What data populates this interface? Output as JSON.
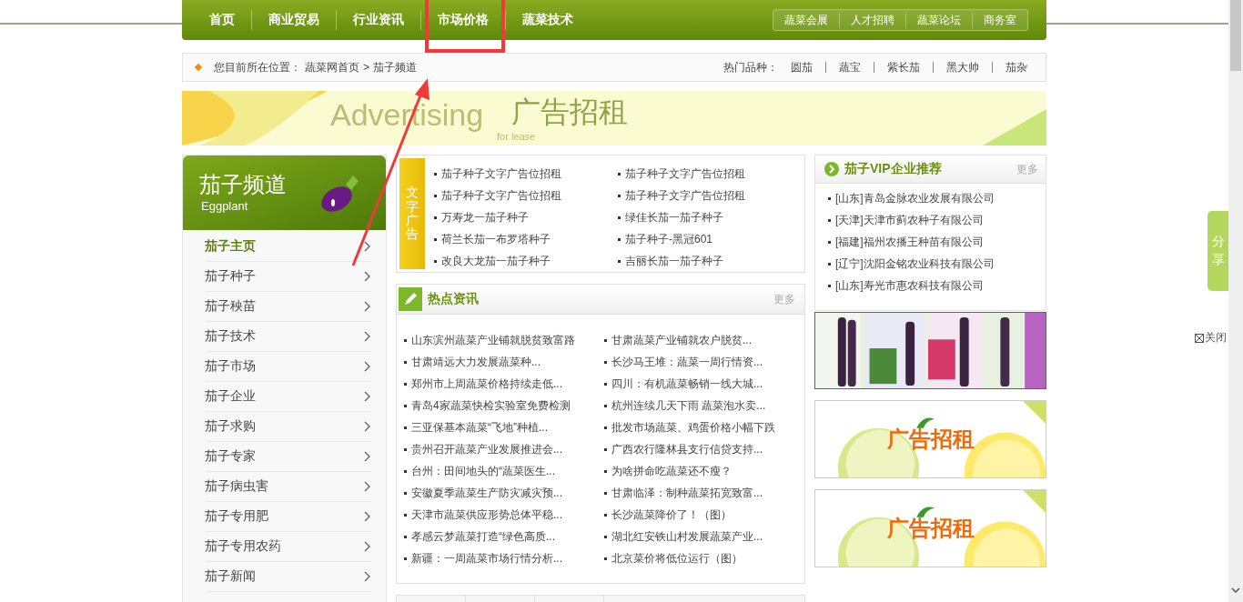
{
  "nav": {
    "items": [
      {
        "label": "首页",
        "annotated": false
      },
      {
        "label": "商业贸易",
        "annotated": false
      },
      {
        "label": "行业资讯",
        "annotated": false
      },
      {
        "label": "市场价格",
        "annotated": true
      },
      {
        "label": "蔬菜技术",
        "annotated": false
      }
    ],
    "sub_items": [
      "蔬菜会展",
      "人才招聘",
      "蔬菜论坛",
      "商务室"
    ]
  },
  "breadcrumb": {
    "prefix": "您目前所在位置：",
    "links": [
      "蔬菜网首页",
      "茄子频道"
    ],
    "separator": ">",
    "hot_label": "热门品种：",
    "hot_items": [
      "圆茄",
      "蔬宝",
      "紫长茄",
      "黑大帅",
      "茄杂"
    ]
  },
  "banner": {
    "word": "Advertising",
    "title": "广告招租",
    "subtitle": "for lease"
  },
  "sidebar": {
    "title": "茄子频道",
    "subtitle": "Eggplant",
    "items": [
      {
        "label": "茄子主页",
        "selected": true
      },
      {
        "label": "茄子种子",
        "selected": false
      },
      {
        "label": "茄子秧苗",
        "selected": false
      },
      {
        "label": "茄子技术",
        "selected": false
      },
      {
        "label": "茄子市场",
        "selected": false
      },
      {
        "label": "茄子企业",
        "selected": false
      },
      {
        "label": "茄子求购",
        "selected": false
      },
      {
        "label": "茄子专家",
        "selected": false
      },
      {
        "label": "茄子病虫害",
        "selected": false
      },
      {
        "label": "茄子专用肥",
        "selected": false
      },
      {
        "label": "茄子专用农药",
        "selected": false
      },
      {
        "label": "茄子新闻",
        "selected": false
      }
    ]
  },
  "text_ads": {
    "tab": "文字广告",
    "items": [
      "茄子种子文字广告位招租",
      "茄子种子文字广告位招租",
      "茄子种子文字广告位招租",
      "茄子种子文字广告位招租",
      "万寿龙一茄子种子",
      "绿佳长茄一茄子种子",
      "荷兰长茄一布罗塔种子",
      "茄子种子-黑冠601",
      "改良大龙茄一茄子种子",
      "吉丽长茄一茄子种子"
    ]
  },
  "hot_news": {
    "title": "热点资讯",
    "more": "更多",
    "items": [
      "山东滨州蔬菜产业铺就脱贫致富路",
      "甘肃蔬菜产业铺就农户脱贫...",
      "甘肃靖远大力发展蔬菜种...",
      "长沙马王堆：蔬菜一周行情资...",
      "郑州市上周蔬菜价格持续走低...",
      "四川：有机蔬菜畅销一线大城...",
      "青岛4家蔬菜快检实验室免费检测",
      "杭州连续几天下雨 蔬菜泡水卖...",
      "三亚保基本蔬菜“飞地”种植...",
      "批发市场蔬菜、鸡蛋价格小幅下跌",
      "贵州召开蔬菜产业发展推进会...",
      "广西农行隆林县支行信贷支持...",
      "台州：田间地头的“蔬菜医生...",
      "为啥拼命吃蔬菜还不瘦？",
      "安徽夏季蔬菜生产防灾减灾预...",
      "甘肃临泽：制种蔬菜拓宽致富...",
      "天津市蔬菜供应形势总体平稳...",
      "长沙蔬菜降价了！（图）",
      "孝感云梦蔬菜打造“绿色高质...",
      "湖北红安铁山村发展蔬菜产业...",
      "新疆：一周蔬菜市场行情分析...",
      "北京菜价将低位运行（图）"
    ]
  },
  "vip": {
    "title": "茄子VIP企业推荐",
    "more": "更多",
    "items": [
      "[山东]青岛金脉农业发展有限公司",
      "[天津]天津市蓟农种子有限公司",
      "[福建]福州农播王种苗有限公司",
      "[辽宁]沈阳金铭农业科技有限公司",
      "[山东]寿光市惠农科技有限公司"
    ]
  },
  "ads": [
    {
      "label": "广告招租"
    },
    {
      "label": "广告招租"
    }
  ],
  "share": {
    "label": "分享",
    "close": "关闭"
  }
}
